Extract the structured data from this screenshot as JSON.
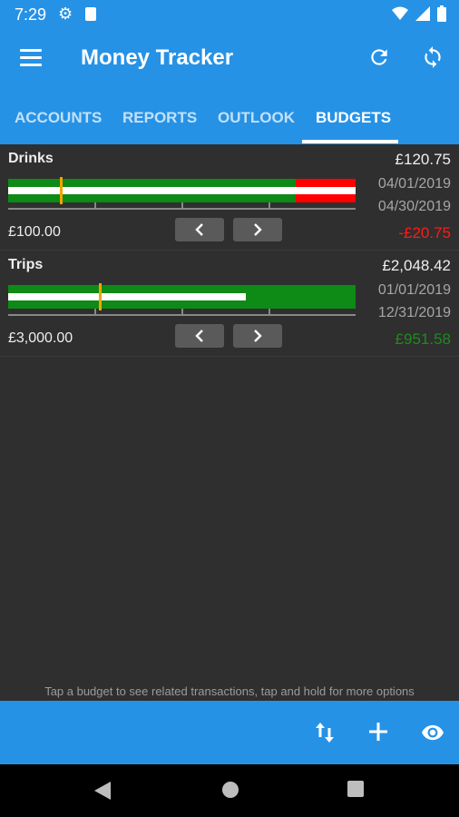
{
  "status_bar": {
    "time": "7:29"
  },
  "app_bar": {
    "title": "Money Tracker"
  },
  "tabs": [
    {
      "label": "ACCOUNTS"
    },
    {
      "label": "REPORTS"
    },
    {
      "label": "OUTLOOK"
    },
    {
      "label": "BUDGETS",
      "active": true
    }
  ],
  "budgets": [
    {
      "name": "Drinks",
      "total": "£120.75",
      "start_date": "04/01/2019",
      "end_date": "04/30/2019",
      "limit": "£100.00",
      "difference": "-£20.75",
      "difference_color": "#ff1a1a",
      "spent_fraction": 1.2075,
      "time_elapsed_fraction": 0.18,
      "over_budget": true
    },
    {
      "name": "Trips",
      "total": "£2,048.42",
      "start_date": "01/01/2019",
      "end_date": "12/31/2019",
      "limit": "£3,000.00",
      "difference": "£951.58",
      "difference_color": "#1f8a1f",
      "spent_fraction": 0.6828,
      "time_elapsed_fraction": 0.26,
      "over_budget": false
    }
  ],
  "hint": "Tap a budget to see related transactions, tap and hold for more options",
  "colors": {
    "primary": "#2692e6",
    "bar_green": "#0e8a16",
    "bar_red": "#ff0000",
    "marker": "#f0a500"
  },
  "icons": {
    "settings": "gear-icon",
    "sd_card": "sd-card-icon",
    "wifi": "wifi-icon",
    "signal": "signal-icon",
    "battery": "battery-icon",
    "menu": "menu-icon",
    "refresh": "refresh-icon",
    "sync": "sync-icon",
    "prev": "chevron-left-icon",
    "next": "chevron-right-icon",
    "sort": "sort-icon",
    "add": "add-icon",
    "visibility": "eye-icon",
    "back": "back-icon",
    "home": "home-icon",
    "recents": "recents-icon"
  }
}
